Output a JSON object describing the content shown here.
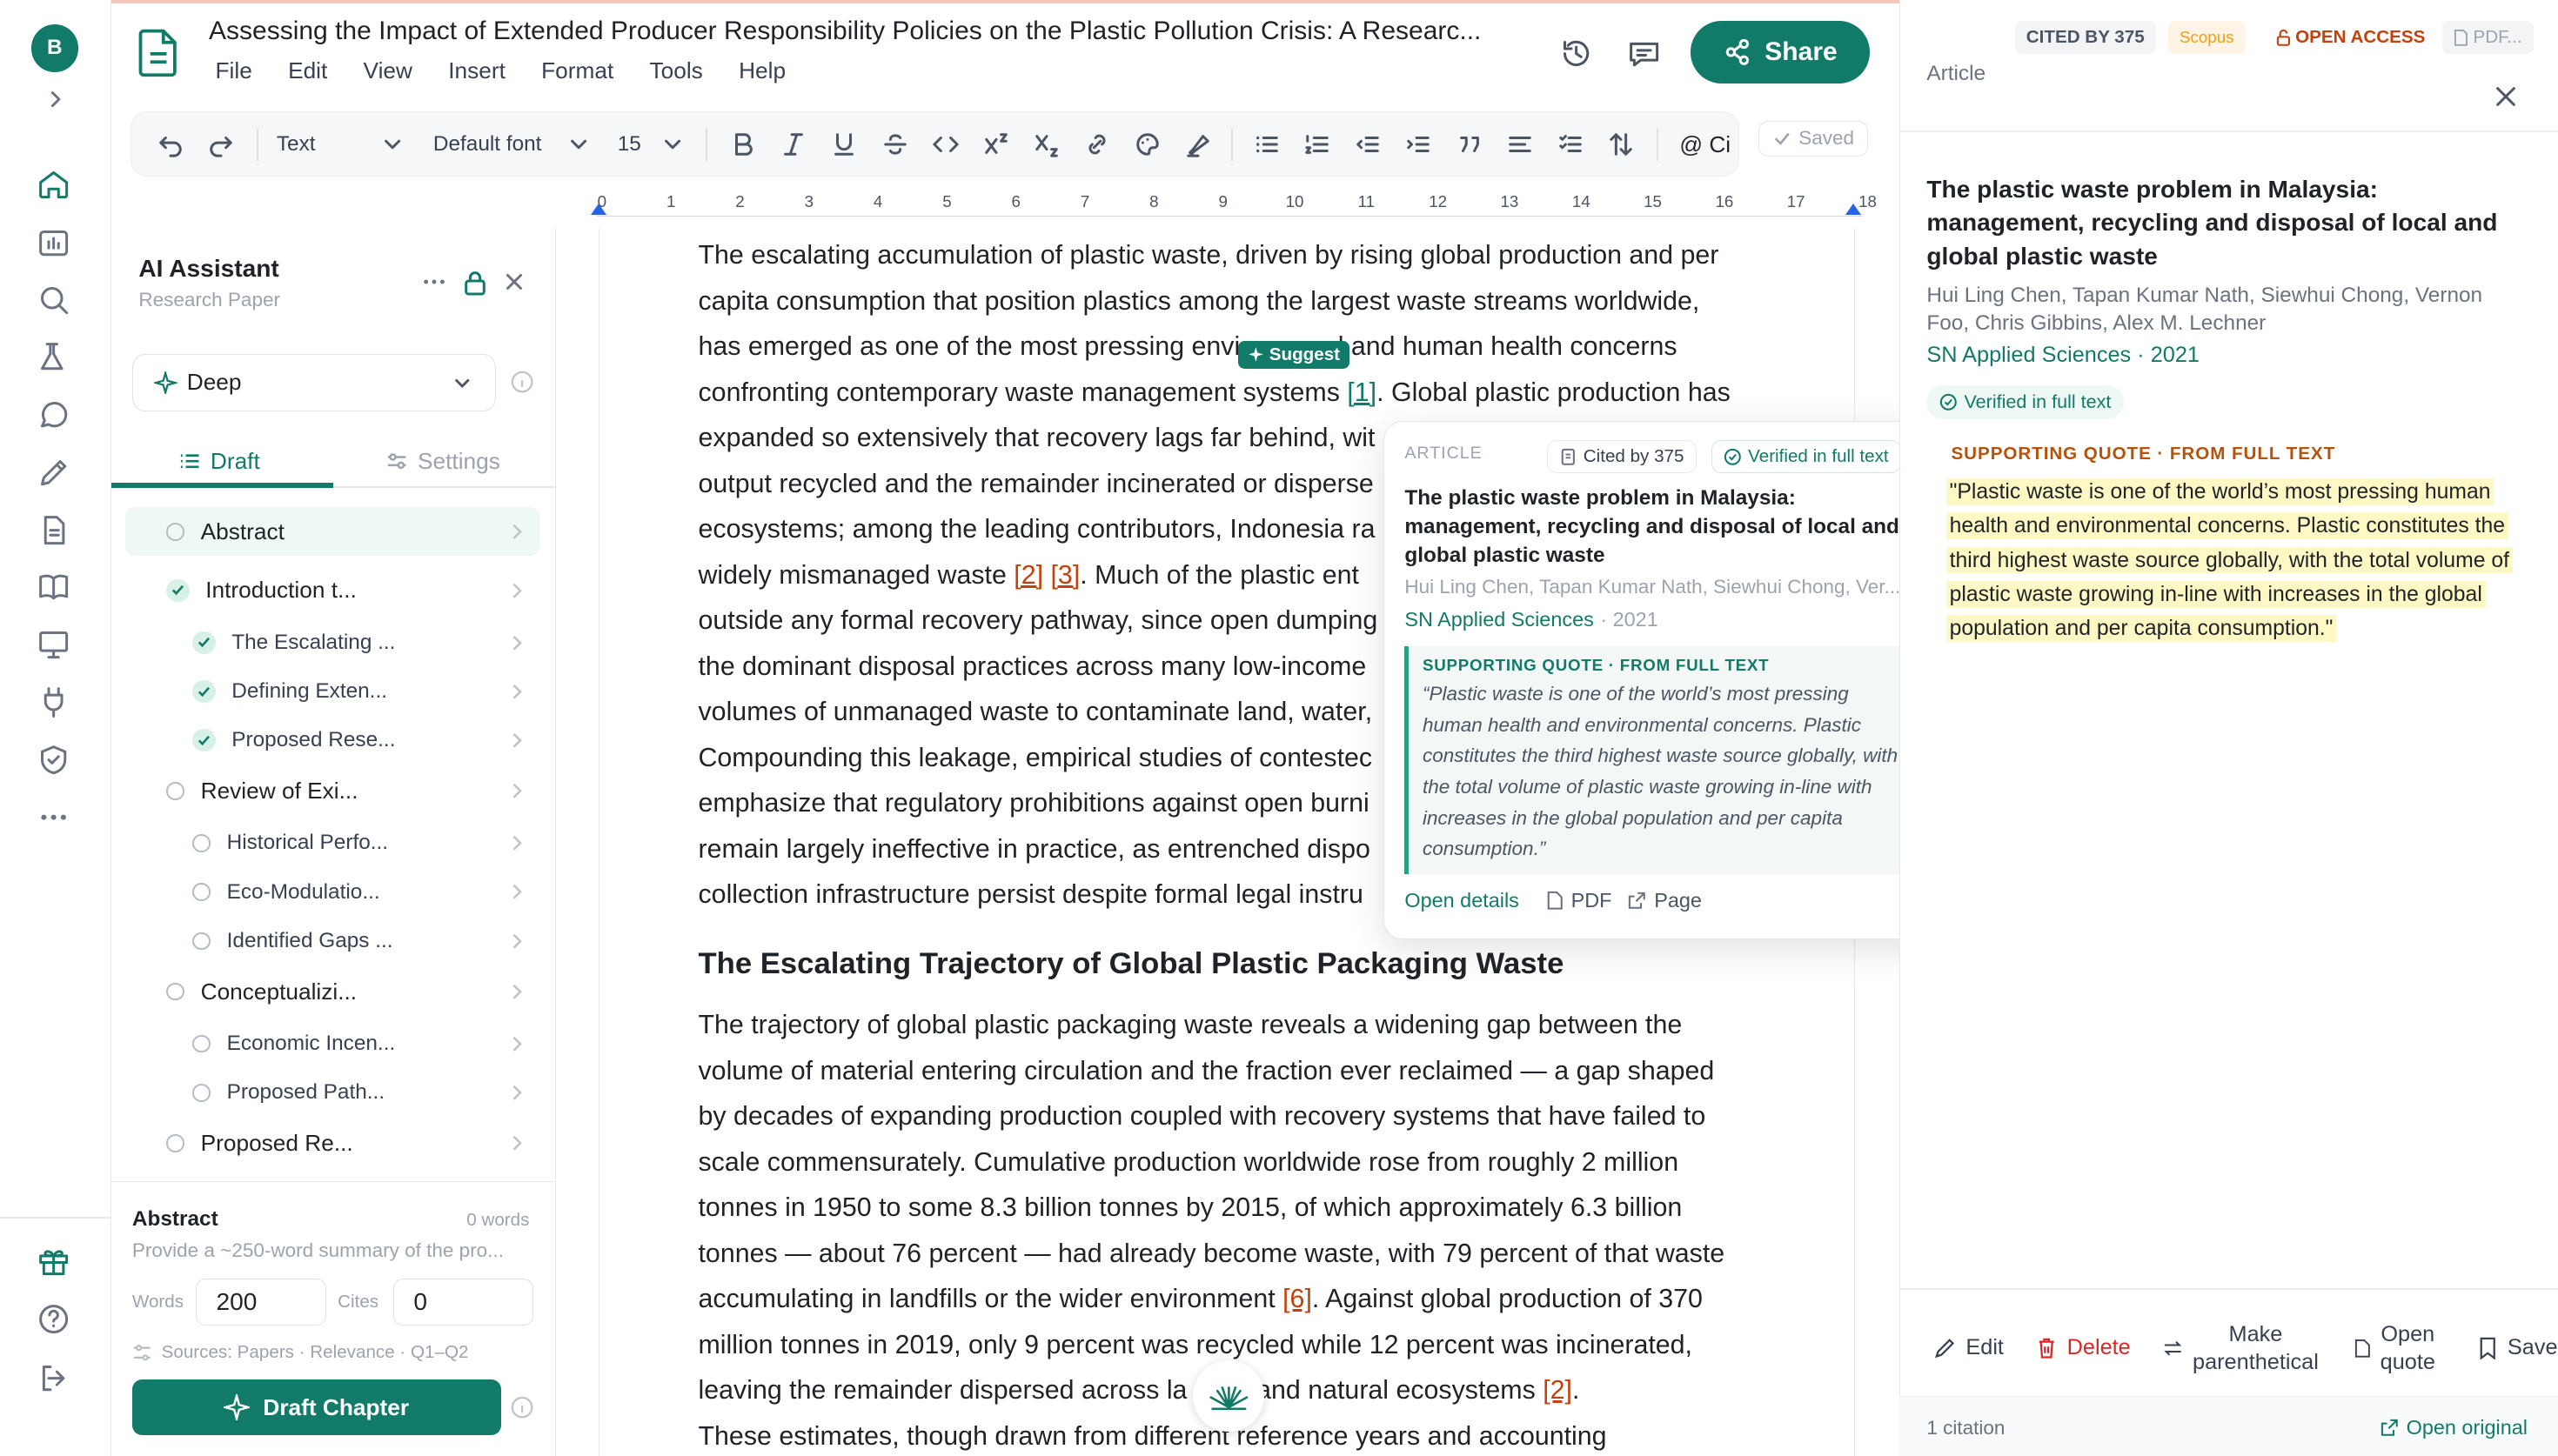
{
  "rail": {
    "avatar_initial": "B"
  },
  "header": {
    "doc_title": "Assessing the Impact of Extended Producer Responsibility Policies on the Plastic Pollution Crisis: A Researc...",
    "menu": [
      "File",
      "Edit",
      "View",
      "Insert",
      "Format",
      "Tools",
      "Help"
    ],
    "share_label": "Share"
  },
  "toolbar": {
    "style_select": "Text",
    "font_select": "Default font",
    "size_select": "15",
    "cite_label": "@ Ci",
    "saved_label": "Saved"
  },
  "ruler": [
    "0",
    "1",
    "2",
    "3",
    "4",
    "5",
    "6",
    "7",
    "8",
    "9",
    "10",
    "11",
    "12",
    "13",
    "14",
    "15",
    "16",
    "17",
    "18"
  ],
  "ai": {
    "title": "AI Assistant",
    "subtitle": "Research Paper",
    "mode": "Deep",
    "tabs": {
      "draft": "Draft",
      "settings": "Settings"
    },
    "outline": [
      {
        "label": "Abstract",
        "level": 0,
        "status": "open",
        "active": true
      },
      {
        "label": "Introduction t...",
        "level": 0,
        "status": "done"
      },
      {
        "label": "The Escalating ...",
        "level": 1,
        "status": "done"
      },
      {
        "label": "Defining Exten...",
        "level": 1,
        "status": "done"
      },
      {
        "label": "Proposed Rese...",
        "level": 1,
        "status": "done"
      },
      {
        "label": "Review of Exi...",
        "level": 0,
        "status": "open"
      },
      {
        "label": "Historical Perfo...",
        "level": 1,
        "status": "open"
      },
      {
        "label": "Eco-Modulatio...",
        "level": 1,
        "status": "open"
      },
      {
        "label": "Identified Gaps ...",
        "level": 1,
        "status": "open"
      },
      {
        "label": "Conceptualizi...",
        "level": 0,
        "status": "open"
      },
      {
        "label": "Economic Incen...",
        "level": 1,
        "status": "open"
      },
      {
        "label": "Proposed Path...",
        "level": 1,
        "status": "open"
      },
      {
        "label": "Proposed Re...",
        "level": 0,
        "status": "open"
      }
    ],
    "abstract_title": "Abstract",
    "abstract_words": "0 words",
    "abstract_hint": "Provide a ~250-word summary of the pro...",
    "words_label": "Words",
    "words_value": "200",
    "cites_label": "Cites",
    "cites_value": "0",
    "sources": "Sources: Papers · Relevance · Q1–Q2",
    "draft_button": "Draft Chapter"
  },
  "editor": {
    "p1": [
      "The escalating accumulation of plastic waste, driven by rising global production and per",
      "capita consumption that position plastics among the largest waste streams worldwide,",
      "has emerged as one of the most pressing envi",
      "l and human health concerns",
      "confronting contemporary waste management systems ",
      "[1]",
      ". Global plastic production has",
      "expanded so extensively that recovery lags far behind, wit",
      "output recycled and the remainder incinerated or disperse",
      "ecosystems; among the leading contributors, Indonesia ra",
      "widely mismanaged waste ",
      "[2]",
      "[3]",
      ". Much of the plastic ent",
      "outside any formal recovery pathway, since open dumping",
      "the dominant disposal practices across many low-income",
      "volumes of unmanaged waste to contaminate land, water,",
      "Compounding this leakage, empirical studies of contestec",
      "emphasize that regulatory prohibitions against open burni",
      "remain largely ineffective in practice, as entrenched dispo",
      "collection infrastructure persist despite formal legal instru"
    ],
    "suggest": "Suggest",
    "heading": "The Escalating Trajectory of Global Plastic Packaging Waste",
    "p2": [
      "The trajectory of global plastic packaging waste reveals a widening gap between the",
      "volume of material entering circulation and the fraction ever reclaimed — a gap shaped",
      "by decades of expanding production coupled with recovery systems that have failed to",
      "scale commensurately. Cumulative production worldwide rose from roughly 2 million",
      "tonnes in 1950 to some 8.3 billion tonnes by 2015, of which approximately 6.3 billion",
      "tonnes — about 76 percent — had already become waste, with 79 percent of that waste",
      "accumulating in landfills or the wider environment ",
      "[6]",
      ". Against global production of 370",
      "million tonnes in 2019, only 9 percent was recycled while 12 percent was incinerated,",
      "leaving the remainder dispersed across la",
      " and natural ecosystems ",
      "[2]",
      ".",
      "These estimates, though drawn from different reference years and accounting"
    ]
  },
  "popover": {
    "kind": "ARTICLE",
    "cited": "Cited by 375",
    "verified": "Verified in full text",
    "title": "The plastic waste problem in Malaysia: management, recycling and disposal of local and global plastic waste",
    "authors": "Hui Ling Chen, Tapan Kumar Nath, Siewhui Chong, Ver...",
    "journal": "SN Applied Sciences",
    "year": "· 2021",
    "quote_label": "SUPPORTING QUOTE · FROM FULL TEXT",
    "quote": "“Plastic waste is one of the world’s most pressing human health and environmental concerns. Plastic constitutes the third highest waste source globally, with the total volume of plastic waste growing in-line with increases in the global population and per capita consumption.”",
    "open_details": "Open details",
    "pdf": "PDF",
    "page": "Page"
  },
  "right": {
    "cited_by": "CITED BY 375",
    "scopus": "Scopus",
    "open_access": "OPEN ACCESS",
    "pdf_tag": "PDF...",
    "section": "Article",
    "title": "The plastic waste problem in Malaysia: management, recycling and disposal of local and global plastic waste",
    "authors": "Hui Ling Chen, Tapan Kumar Nath, Siewhui Chong, Vernon Foo, Chris Gibbins, Alex M. Lechner",
    "journal": "SN Applied Sciences · 2021",
    "verified": "Verified in full text",
    "quote_label": "SUPPORTING QUOTE · FROM FULL TEXT",
    "quote": "\"Plastic waste is one of the world’s most pressing human health and environmental concerns. Plastic constitutes the third highest waste source globally, with the total volume of plastic waste growing in-line with increases in the global population and per capita consumption.\"",
    "actions": {
      "edit": "Edit",
      "delete": "Delete",
      "parenthetical_1": "Make",
      "parenthetical_2": "parenthetical",
      "open_quote_1": "Open",
      "open_quote_2": "quote",
      "save": "Save"
    },
    "citation_count": "1 citation",
    "open_original": "Open original"
  },
  "colors": {
    "accent": "#127a68",
    "cite": "#c2410c",
    "highlight": "#fdf8c4",
    "open_access": "#c2410c"
  }
}
